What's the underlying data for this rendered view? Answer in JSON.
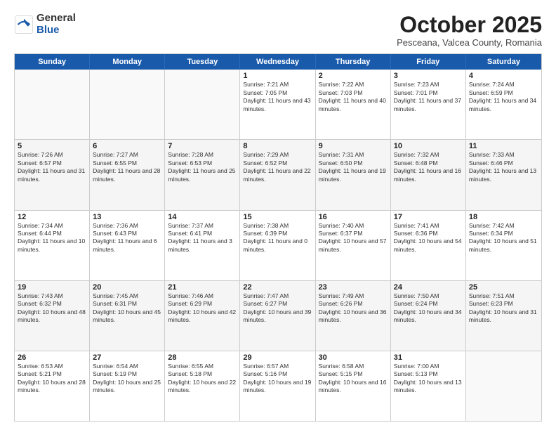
{
  "logo": {
    "general": "General",
    "blue": "Blue"
  },
  "title": "October 2025",
  "subtitle": "Pesceana, Valcea County, Romania",
  "days": [
    "Sunday",
    "Monday",
    "Tuesday",
    "Wednesday",
    "Thursday",
    "Friday",
    "Saturday"
  ],
  "rows": [
    [
      {
        "day": "",
        "content": ""
      },
      {
        "day": "",
        "content": ""
      },
      {
        "day": "",
        "content": ""
      },
      {
        "day": "1",
        "content": "Sunrise: 7:21 AM\nSunset: 7:05 PM\nDaylight: 11 hours and 43 minutes."
      },
      {
        "day": "2",
        "content": "Sunrise: 7:22 AM\nSunset: 7:03 PM\nDaylight: 11 hours and 40 minutes."
      },
      {
        "day": "3",
        "content": "Sunrise: 7:23 AM\nSunset: 7:01 PM\nDaylight: 11 hours and 37 minutes."
      },
      {
        "day": "4",
        "content": "Sunrise: 7:24 AM\nSunset: 6:59 PM\nDaylight: 11 hours and 34 minutes."
      }
    ],
    [
      {
        "day": "5",
        "content": "Sunrise: 7:26 AM\nSunset: 6:57 PM\nDaylight: 11 hours and 31 minutes."
      },
      {
        "day": "6",
        "content": "Sunrise: 7:27 AM\nSunset: 6:55 PM\nDaylight: 11 hours and 28 minutes."
      },
      {
        "day": "7",
        "content": "Sunrise: 7:28 AM\nSunset: 6:53 PM\nDaylight: 11 hours and 25 minutes."
      },
      {
        "day": "8",
        "content": "Sunrise: 7:29 AM\nSunset: 6:52 PM\nDaylight: 11 hours and 22 minutes."
      },
      {
        "day": "9",
        "content": "Sunrise: 7:31 AM\nSunset: 6:50 PM\nDaylight: 11 hours and 19 minutes."
      },
      {
        "day": "10",
        "content": "Sunrise: 7:32 AM\nSunset: 6:48 PM\nDaylight: 11 hours and 16 minutes."
      },
      {
        "day": "11",
        "content": "Sunrise: 7:33 AM\nSunset: 6:46 PM\nDaylight: 11 hours and 13 minutes."
      }
    ],
    [
      {
        "day": "12",
        "content": "Sunrise: 7:34 AM\nSunset: 6:44 PM\nDaylight: 11 hours and 10 minutes."
      },
      {
        "day": "13",
        "content": "Sunrise: 7:36 AM\nSunset: 6:43 PM\nDaylight: 11 hours and 6 minutes."
      },
      {
        "day": "14",
        "content": "Sunrise: 7:37 AM\nSunset: 6:41 PM\nDaylight: 11 hours and 3 minutes."
      },
      {
        "day": "15",
        "content": "Sunrise: 7:38 AM\nSunset: 6:39 PM\nDaylight: 11 hours and 0 minutes."
      },
      {
        "day": "16",
        "content": "Sunrise: 7:40 AM\nSunset: 6:37 PM\nDaylight: 10 hours and 57 minutes."
      },
      {
        "day": "17",
        "content": "Sunrise: 7:41 AM\nSunset: 6:36 PM\nDaylight: 10 hours and 54 minutes."
      },
      {
        "day": "18",
        "content": "Sunrise: 7:42 AM\nSunset: 6:34 PM\nDaylight: 10 hours and 51 minutes."
      }
    ],
    [
      {
        "day": "19",
        "content": "Sunrise: 7:43 AM\nSunset: 6:32 PM\nDaylight: 10 hours and 48 minutes."
      },
      {
        "day": "20",
        "content": "Sunrise: 7:45 AM\nSunset: 6:31 PM\nDaylight: 10 hours and 45 minutes."
      },
      {
        "day": "21",
        "content": "Sunrise: 7:46 AM\nSunset: 6:29 PM\nDaylight: 10 hours and 42 minutes."
      },
      {
        "day": "22",
        "content": "Sunrise: 7:47 AM\nSunset: 6:27 PM\nDaylight: 10 hours and 39 minutes."
      },
      {
        "day": "23",
        "content": "Sunrise: 7:49 AM\nSunset: 6:26 PM\nDaylight: 10 hours and 36 minutes."
      },
      {
        "day": "24",
        "content": "Sunrise: 7:50 AM\nSunset: 6:24 PM\nDaylight: 10 hours and 34 minutes."
      },
      {
        "day": "25",
        "content": "Sunrise: 7:51 AM\nSunset: 6:23 PM\nDaylight: 10 hours and 31 minutes."
      }
    ],
    [
      {
        "day": "26",
        "content": "Sunrise: 6:53 AM\nSunset: 5:21 PM\nDaylight: 10 hours and 28 minutes."
      },
      {
        "day": "27",
        "content": "Sunrise: 6:54 AM\nSunset: 5:19 PM\nDaylight: 10 hours and 25 minutes."
      },
      {
        "day": "28",
        "content": "Sunrise: 6:55 AM\nSunset: 5:18 PM\nDaylight: 10 hours and 22 minutes."
      },
      {
        "day": "29",
        "content": "Sunrise: 6:57 AM\nSunset: 5:16 PM\nDaylight: 10 hours and 19 minutes."
      },
      {
        "day": "30",
        "content": "Sunrise: 6:58 AM\nSunset: 5:15 PM\nDaylight: 10 hours and 16 minutes."
      },
      {
        "day": "31",
        "content": "Sunrise: 7:00 AM\nSunset: 5:13 PM\nDaylight: 10 hours and 13 minutes."
      },
      {
        "day": "",
        "content": ""
      }
    ]
  ]
}
